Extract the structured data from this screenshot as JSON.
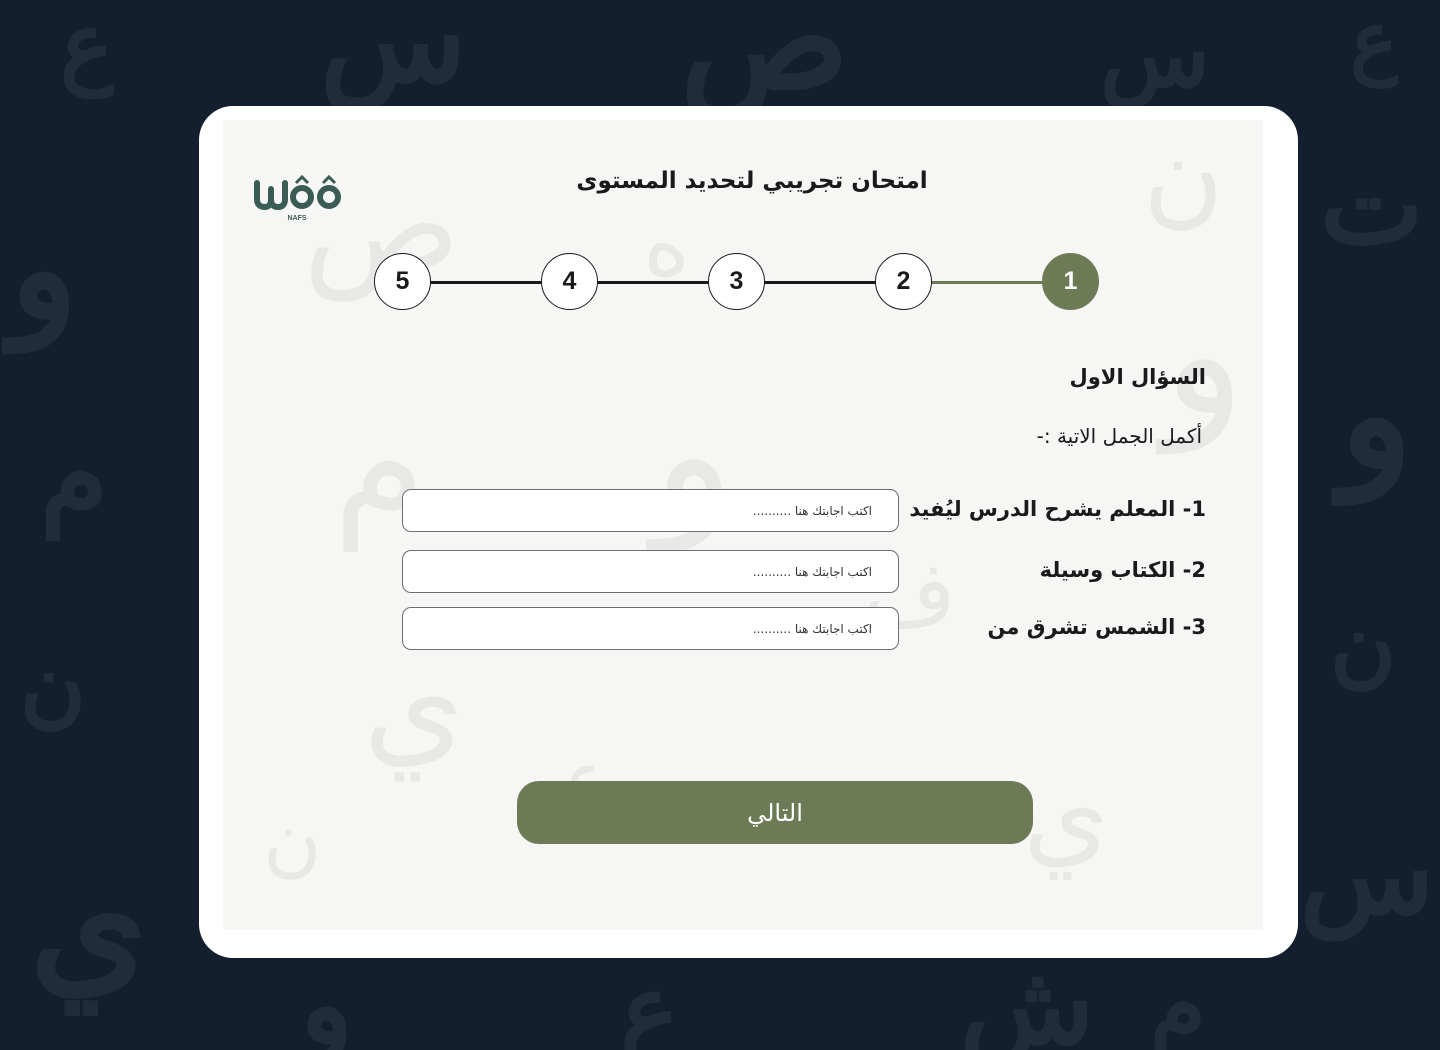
{
  "page": {
    "title": "امتحان تجريبي لتحديد المستوى",
    "logo_text": "NAFS"
  },
  "stepper": {
    "steps": [
      "1",
      "2",
      "3",
      "4",
      "5"
    ],
    "active": "1"
  },
  "question": {
    "heading": "السؤال الاول",
    "instruction": "أكمل الجمل الاتية :-",
    "items": [
      {
        "label": "1- المعلم يشرح الدرس ليُفيد",
        "placeholder": "اكتب اجابتك هنا ..........",
        "value": ""
      },
      {
        "label": "2- الكتاب وسيلة",
        "placeholder": "اكتب اجابتك هنا ..........",
        "value": ""
      },
      {
        "label": "3- الشمس تشرق من",
        "placeholder": "اكتب اجابتك هنا ..........",
        "value": ""
      }
    ]
  },
  "actions": {
    "next_label": "التالي"
  },
  "colors": {
    "page_background": "#131e2f",
    "card_background": "#ffffff",
    "accent": "#6c7b55",
    "text": "#1a1a1a",
    "logo": "#3b5c55"
  }
}
